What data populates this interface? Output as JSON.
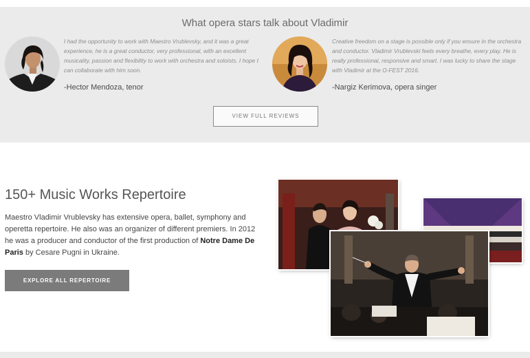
{
  "reviews": {
    "title": "What opera stars talk about Vladimir",
    "items": [
      {
        "quote": "I had the opportunity to work with Maestro Vrublevsky, and it was a great experience, he is a great conductor, very professional, with an excellent musicality, passion and flexibility to work with orchestra and soloists. I hope I can collaborate with him soon.",
        "author": "-Hector Mendoza, tenor"
      },
      {
        "quote": "Creative freedom on a stage is possible only if you ensure in the orchestra and conductor. Vladimir Vrublevski feels every breathe, every play. He is really professional, responsive and smart. I was lucky to share the stage with Vladimir at the O-FEST 2016.",
        "author": "-Nargiz Kerimova, opera singer"
      }
    ],
    "button_label": "VIEW FULL REVIEWS"
  },
  "repertoire": {
    "title": "150+ Music Works Repertoire",
    "text_before": "Maestro Vladimir Vrublevsky has extensive opera, ballet, symphony and operetta repertoire. He also was an organizer of different premiers. In 2012 he was a producer and conductor of the first production of ",
    "text_bold": "Notre Dame De Paris",
    "text_after": " by Cesare Pugni in Ukraine.",
    "button_label": "EXPLORE ALL REPERTOIRE"
  },
  "colors": {
    "band_background": "#ebebeb",
    "button_dark": "#7b7b7b",
    "quote_text": "#8c8c8c"
  }
}
